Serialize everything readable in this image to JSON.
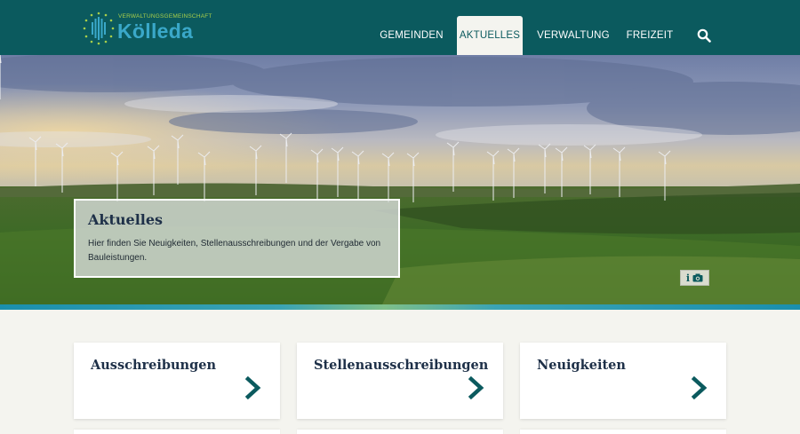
{
  "logo": {
    "small_text": "VERWALTUNGSGEMEINSCHAFT",
    "big_text": "Kölleda",
    "icon": "logo-icon"
  },
  "nav": {
    "items": [
      {
        "label": "GEMEINDEN",
        "active": false
      },
      {
        "label": "AKTUELLES",
        "active": true
      },
      {
        "label": "VERWALTUNG",
        "active": false
      },
      {
        "label": "FREIZEIT",
        "active": false
      }
    ],
    "search_icon": "search-icon"
  },
  "hero": {
    "title": "Aktuelles",
    "text": "Hier finden Sie Neuigkeiten, Stellenausschreibungen und der Vergabe von Bauleistungen.",
    "badge_info": "i",
    "badge_icon": "camera-icon"
  },
  "cards": [
    {
      "title": "Ausschreibungen",
      "icon": "chevron-right-icon"
    },
    {
      "title": "Stellenausschreibungen",
      "icon": "chevron-right-icon"
    },
    {
      "title": "Neuigkeiten",
      "icon": "chevron-right-icon"
    }
  ],
  "colors": {
    "header_bg": "#0b5a5e",
    "accent_teal": "#0b5a5e",
    "logo_green": "#a9cf4a",
    "logo_blue": "#3aa8c9",
    "page_bg": "#f4f4ef",
    "heading": "#1e3048"
  }
}
